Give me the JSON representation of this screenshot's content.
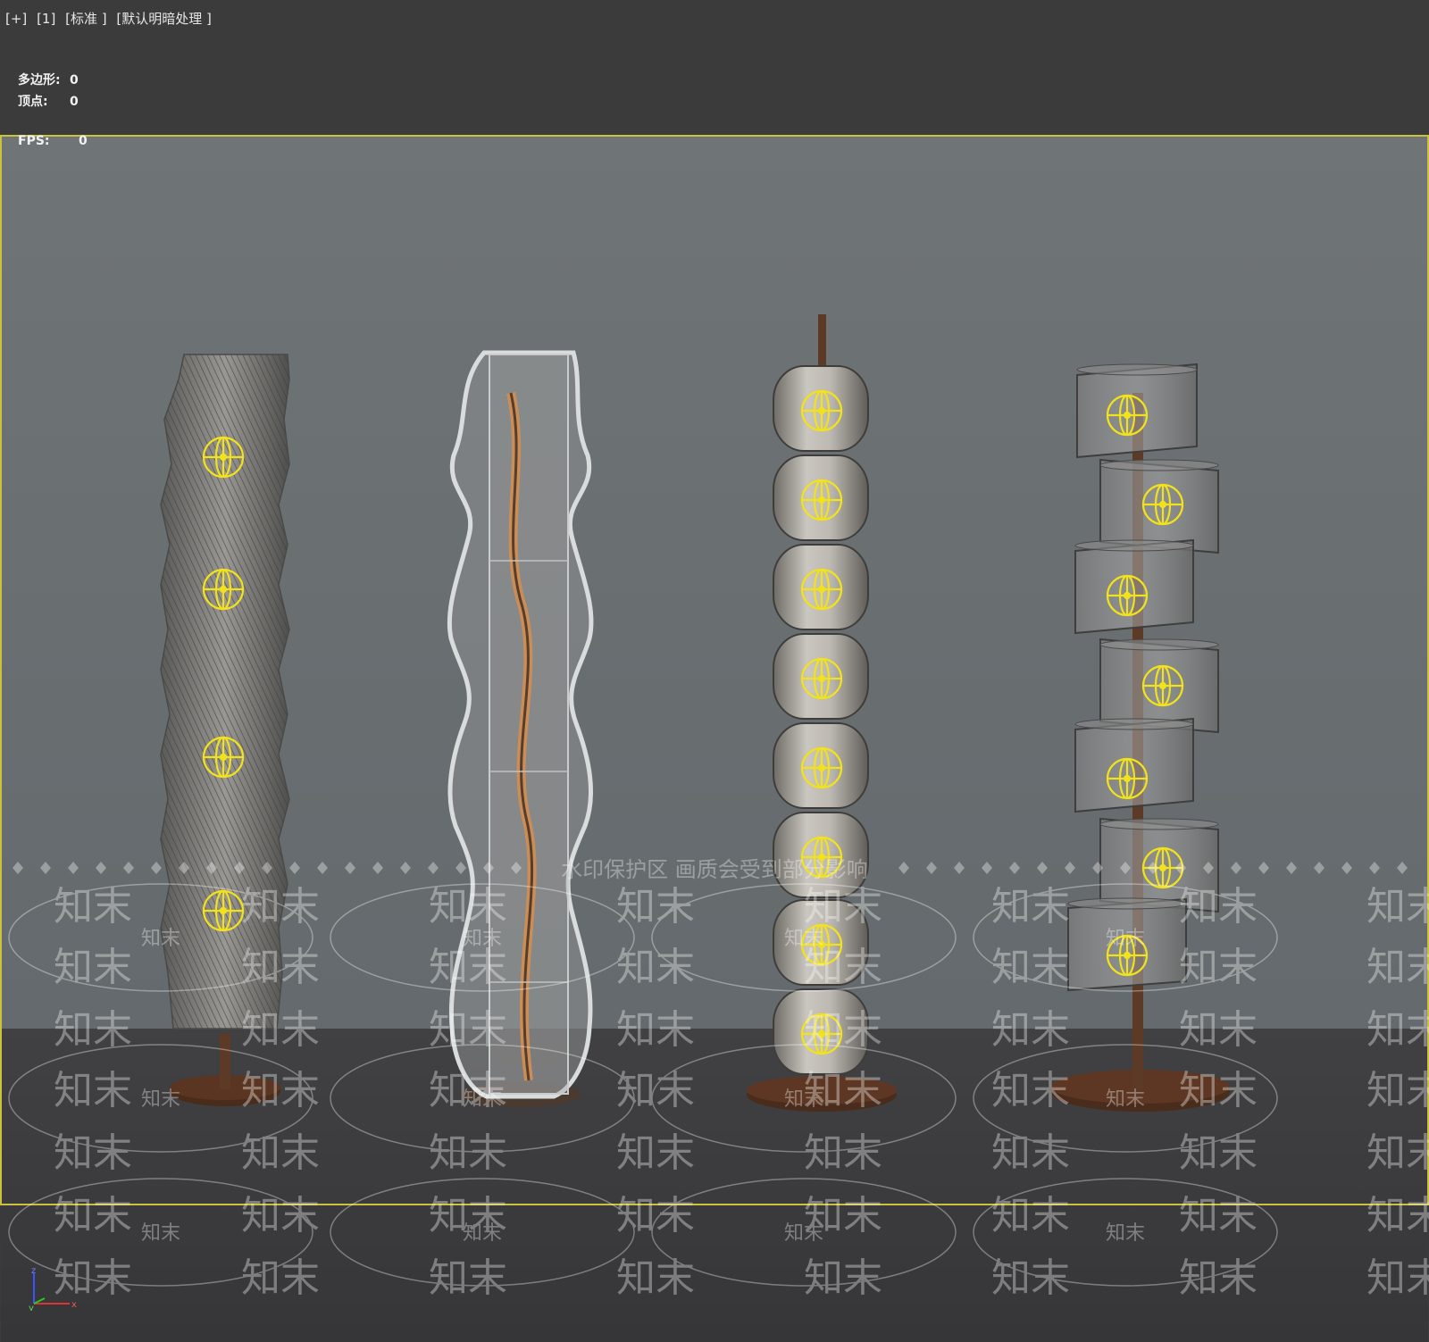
{
  "viewport": {
    "menu": {
      "plus": "[+]",
      "view": "[1]",
      "shading": "[标准 ]",
      "lighting": "[默认明暗处理 ]"
    },
    "stats": {
      "polygons_label": "多边形:",
      "polygons_value": "0",
      "vertices_label": "顶点:",
      "vertices_value": "0",
      "fps_label": "FPS:",
      "fps_value": "0"
    },
    "axis": {
      "z": "z",
      "y": "y",
      "x": "x"
    }
  },
  "watermark": {
    "banner": "水印保护区   画质会受到部分影响",
    "logo_text": "知末",
    "small_text": "知末"
  },
  "colors": {
    "frame_bg": "#3b3b3b",
    "backdrop": "#6a6f71",
    "floor": "#3c3c3e",
    "safe_frame": "#c9c23a",
    "light_gizmo": "#f2e21a",
    "wood": "#5a3522"
  },
  "scene": {
    "objects": [
      {
        "name": "floor-lamp-twisted-ribbed"
      },
      {
        "name": "floor-lamp-wavy-glass"
      },
      {
        "name": "floor-lamp-stacked-globes"
      },
      {
        "name": "floor-lamp-spiral-cylinders"
      }
    ]
  }
}
